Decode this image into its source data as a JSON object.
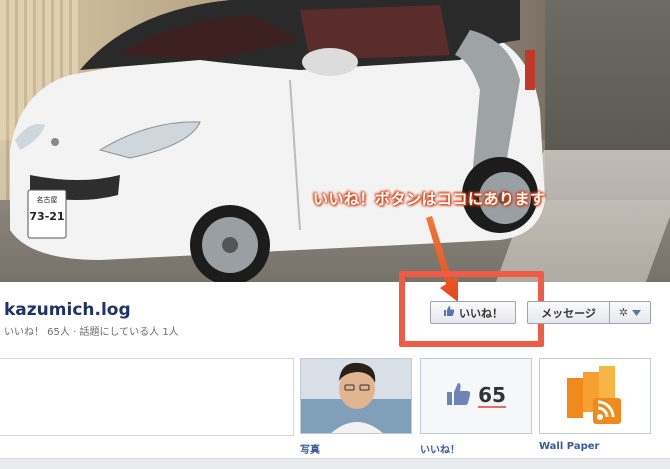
{
  "annotation": {
    "text": "いいね！ボタンはココにあります"
  },
  "car": {
    "plate_line1": "名古屋",
    "plate_number": "73-21"
  },
  "page": {
    "name": "kazumich.log",
    "subline": "いいね！ 65人 · 話題にしている人 1人"
  },
  "buttons": {
    "like_label": "いいね！",
    "message_label": "メッセージ"
  },
  "tiles": [
    {
      "label": "写真"
    },
    {
      "label": "いいね！",
      "count": "65"
    },
    {
      "label": "Wall Paper"
    }
  ],
  "colors": {
    "accent": "#ef5b45",
    "link": "#3b5998",
    "name": "#1f3464"
  }
}
